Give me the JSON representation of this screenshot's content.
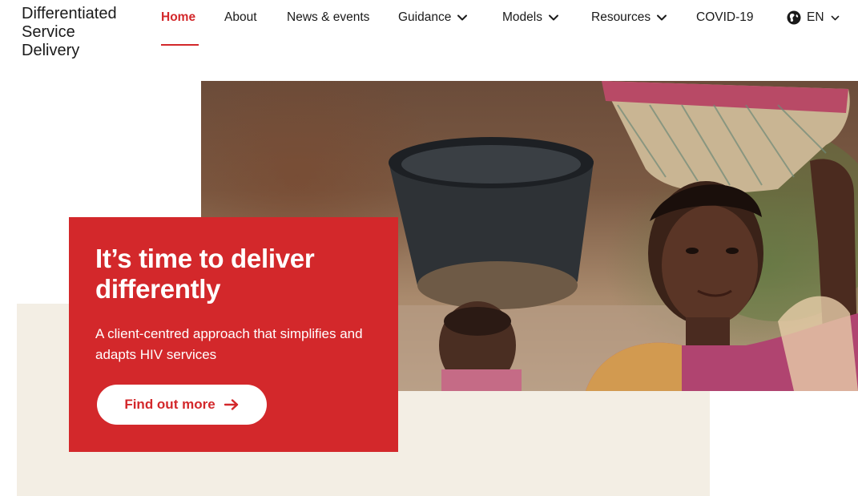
{
  "logo": {
    "line1": "Differentiated",
    "line2": "Service",
    "line3": "Delivery"
  },
  "nav": {
    "items": [
      {
        "label": "Home",
        "active": true,
        "dropdown": false
      },
      {
        "label": "About",
        "active": false,
        "dropdown": false
      },
      {
        "label": "News & events",
        "active": false,
        "dropdown": false
      },
      {
        "label": "Guidance",
        "active": false,
        "dropdown": true
      },
      {
        "label": "Models",
        "active": false,
        "dropdown": true
      },
      {
        "label": "Resources",
        "active": false,
        "dropdown": true
      },
      {
        "label": "COVID-19",
        "active": false,
        "dropdown": false
      }
    ],
    "language": {
      "label": "EN",
      "icon": "globe-icon"
    }
  },
  "hero": {
    "title": "It’s time to deliver differently",
    "subtitle": "A client-centred approach that simplifies and adapts HIV services",
    "cta_label": "Find out more",
    "cta_icon": "arrow-right-icon",
    "image_icon": "hero-photo"
  },
  "colors": {
    "accent": "#d3282b",
    "beige": "#f3eee4",
    "text": "#1a1a1a",
    "white": "#ffffff"
  }
}
